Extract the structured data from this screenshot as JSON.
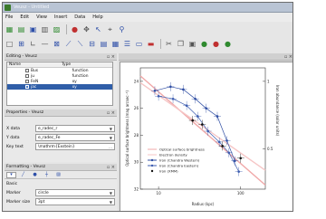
{
  "window": {
    "title": "Veusz - Untitled"
  },
  "menu": [
    "File",
    "Edit",
    "View",
    "Insert",
    "Data",
    "Help"
  ],
  "toolbar1": [
    {
      "icon": "new-document-icon"
    },
    {
      "icon": "open-icon"
    },
    {
      "icon": "save-icon"
    },
    {
      "icon": "print-icon"
    },
    {
      "icon": "export-icon"
    },
    {
      "icon": "undo-icon"
    },
    {
      "icon": "pointer-icon"
    },
    {
      "icon": "zoom-icon"
    },
    {
      "icon": "select-icon"
    },
    {
      "icon": "pick-icon"
    },
    {
      "icon": "magnifier-icon"
    }
  ],
  "toolbar2": [
    {
      "icon": "add-page-icon"
    },
    {
      "icon": "add-grid-icon"
    },
    {
      "icon": "add-graph-icon"
    },
    {
      "icon": "add-axis-icon"
    },
    {
      "icon": "add-xy-icon"
    },
    {
      "icon": "add-bar-icon"
    },
    {
      "icon": "add-fit-icon"
    },
    {
      "icon": "add-function-icon"
    },
    {
      "icon": "add-image-icon"
    },
    {
      "icon": "add-contour-icon"
    },
    {
      "icon": "add-key-icon"
    },
    {
      "icon": "add-label-icon"
    },
    {
      "icon": "add-shape-icon"
    },
    {
      "icon": "cut-icon"
    },
    {
      "icon": "copy-icon"
    },
    {
      "icon": "paste-icon"
    },
    {
      "icon": "move-up-icon"
    },
    {
      "icon": "delete-icon"
    },
    {
      "icon": "move-down-icon"
    }
  ],
  "editing": {
    "title": "Editing - Veusz",
    "columns": [
      "Name",
      "Type"
    ],
    "rows": [
      {
        "name": "Bus",
        "type": "function",
        "selected": false
      },
      {
        "name": "ju",
        "type": "function",
        "selected": false
      },
      {
        "name": "FeN",
        "type": "xy",
        "selected": false
      },
      {
        "name": "jac",
        "type": "xy",
        "selected": true
      }
    ]
  },
  "properties": {
    "title": "Properties - Veusz",
    "rows": [
      {
        "label": "X data",
        "value": "e_radec_r"
      },
      {
        "label": "Y data",
        "value": "e_radec_Fe"
      },
      {
        "label": "Key text",
        "value": "\\mathrm{Exstein}"
      }
    ]
  },
  "formatting": {
    "title": "Formatting - Veusz",
    "tabs": [
      "main",
      "line",
      "marker",
      "error",
      "fill"
    ],
    "section": "Basic",
    "rows": [
      {
        "label": "Marker",
        "value": "circle"
      },
      {
        "label": "Marker size",
        "value": "3pt"
      }
    ]
  },
  "plot": {
    "title": "",
    "ylabel_left": "Optical surface brightness (mag arcsec⁻²)",
    "ylabel_right": "Iron abundance (solar units)",
    "xlabel": "Radius (kpc)",
    "xticks": [
      "10",
      "100"
    ],
    "yticks_left": [
      "24",
      "26",
      "28",
      "30",
      "32"
    ],
    "yticks_right": [
      "1",
      "0.5"
    ]
  },
  "chart_data": {
    "type": "scatter",
    "xlabel": "Radius (kpc)",
    "ylabel": "Optical surface brightness (mag arcsec⁻²)",
    "y2label": "Iron abundance (solar units)",
    "xscale": "log",
    "xlim": [
      6,
      200
    ],
    "ylim": [
      32,
      23
    ],
    "grid": false,
    "legend": "lower-left",
    "series": [
      {
        "name": "Optical surface brightness",
        "style": "line",
        "color": "#f0a8a8",
        "x": [
          6,
          200
        ],
        "y": [
          23.6,
          31.7
        ]
      },
      {
        "name": "Electron density",
        "style": "line",
        "color": "#f6c6c6",
        "x": [
          6,
          200
        ],
        "y": [
          24.1,
          30.6
        ]
      },
      {
        "name": "Iron (Chandra Western)",
        "style": "line+markers",
        "color": "#2f4ea3",
        "x": [
          9,
          14,
          20,
          28,
          38,
          52,
          68,
          85
        ],
        "y": [
          24.7,
          24.4,
          24.6,
          25.3,
          26.0,
          26.6,
          28.4,
          29.9
        ]
      },
      {
        "name": "Iron (Chandra Eastern)",
        "style": "line+markers",
        "color": "#3d5db0",
        "x": [
          10,
          15,
          22,
          30,
          40,
          55,
          72,
          95
        ],
        "y": [
          25.1,
          25.3,
          25.8,
          26.6,
          27.7,
          28.5,
          29.3,
          30.7
        ]
      },
      {
        "name": "Iron (XMM)",
        "style": "markers",
        "color": "#111111",
        "x": [
          26,
          34,
          60,
          100
        ],
        "y": [
          26.9,
          27.2,
          28.8,
          29.7
        ]
      }
    ]
  },
  "colors": {
    "accent": "#2f5ea8",
    "pink": "#f0a8a8",
    "blue": "#2f4ea3"
  }
}
